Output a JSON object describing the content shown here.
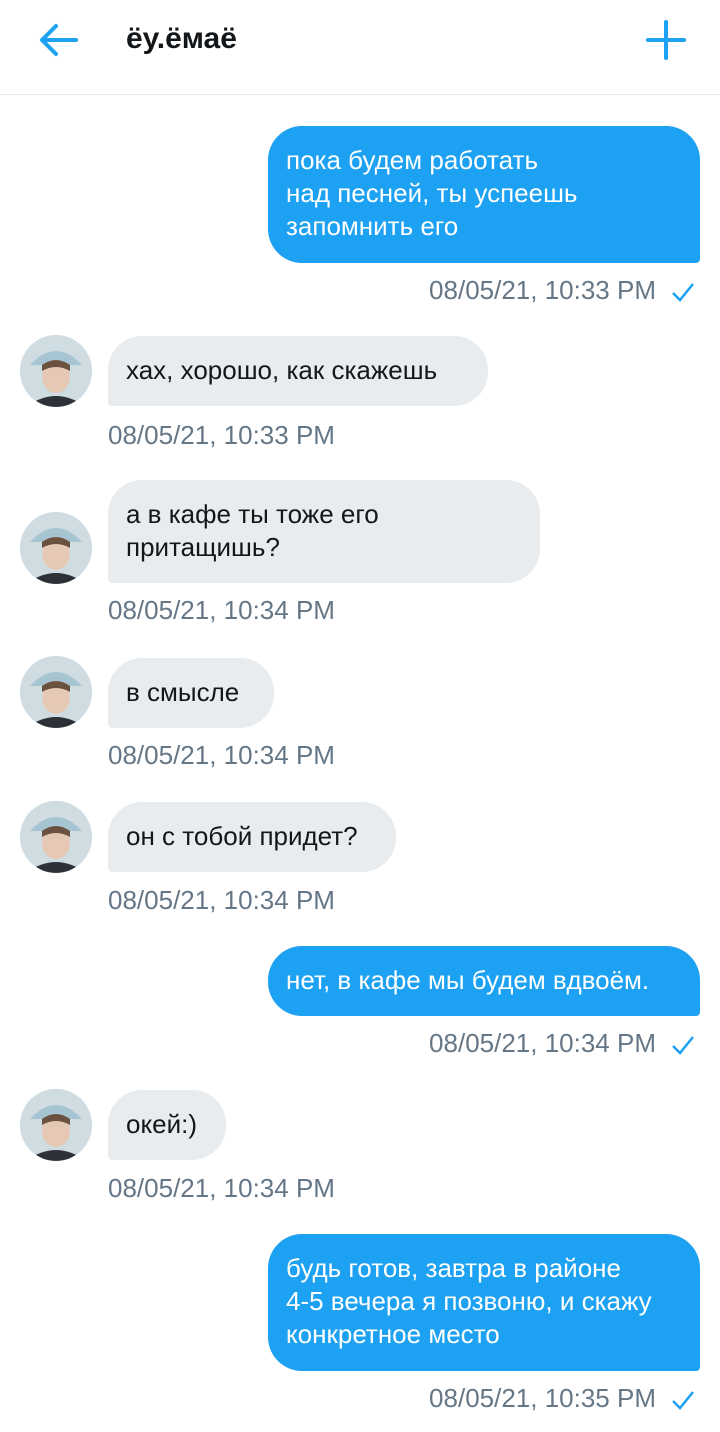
{
  "header": {
    "title": "ёу.ёмаё",
    "back_icon": "arrow-left-icon",
    "new_icon": "plus-icon",
    "accent": "#1da1f2"
  },
  "messages": [
    {
      "dir": "out",
      "text": "пока будем работать\nнад песней, ты успеешь\nзапомнить его",
      "time": "08/05/21, 10:33 PM"
    },
    {
      "dir": "in",
      "text": "хах, хорошо, как скажешь",
      "time": "08/05/21, 10:33 PM"
    },
    {
      "dir": "in",
      "text": "а в кафе ты тоже его\nпритащишь?",
      "time": "08/05/21, 10:34 PM"
    },
    {
      "dir": "in",
      "text": "в смысле",
      "time": "08/05/21, 10:34 PM"
    },
    {
      "dir": "in",
      "text": "он с тобой придет?",
      "time": "08/05/21, 10:34 PM"
    },
    {
      "dir": "out",
      "text": "нет, в кафе мы будем вдвоём.",
      "time": "08/05/21, 10:34 PM"
    },
    {
      "dir": "in",
      "text": "окей:)",
      "time": "08/05/21, 10:34 PM"
    },
    {
      "dir": "out",
      "text": "будь готов, завтра в районе\n4-5 вечера я позвоню, и скажу\nконкретное место",
      "time": "08/05/21, 10:35 PM"
    }
  ]
}
